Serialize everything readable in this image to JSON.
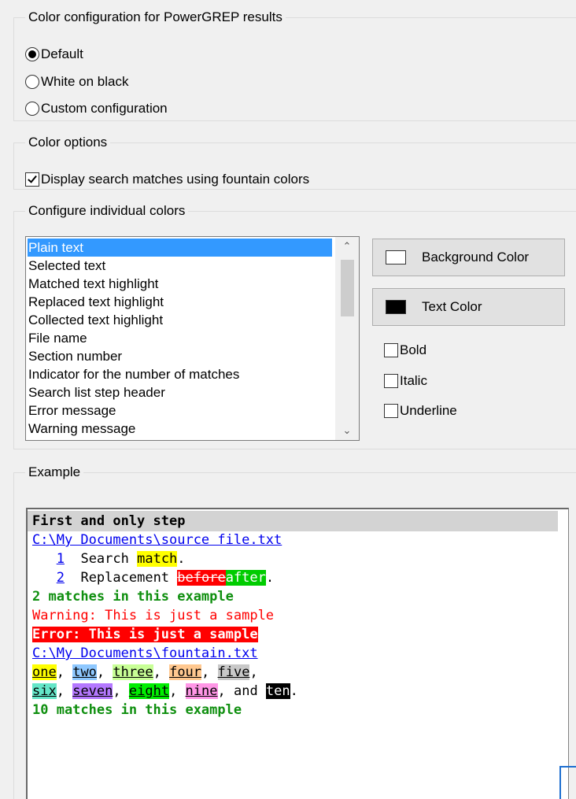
{
  "color_config": {
    "legend": "Color configuration for PowerGREP results",
    "options": [
      {
        "label": "Default",
        "selected": true
      },
      {
        "label": "White on black",
        "selected": false
      },
      {
        "label": "Custom configuration",
        "selected": false
      }
    ]
  },
  "color_options": {
    "legend": "Color options",
    "fountain_label": "Display search matches using fountain colors",
    "fountain_checked": true
  },
  "individual": {
    "legend": "Configure individual colors",
    "items": [
      "Plain text",
      "Selected text",
      "Matched text highlight",
      "Replaced text highlight",
      "Collected text highlight",
      "File name",
      "Section number",
      "Indicator for the number of matches",
      "Search list step header",
      "Error message",
      "Warning message"
    ],
    "selected_index": 0,
    "background_button": "Background Color",
    "text_button": "Text Color",
    "background_swatch": "#ffffff",
    "text_swatch": "#000000",
    "bold_label": "Bold",
    "italic_label": "Italic",
    "underline_label": "Underline"
  },
  "example": {
    "legend": "Example",
    "step_header": "First and only step",
    "file1": "C:\\My Documents\\source file.txt",
    "line1_num": "1",
    "line1_text": "Search ",
    "line1_match": "match",
    "line1_end": ".",
    "line2_num": "2",
    "line2_text": "Replacement ",
    "line2_before": "before",
    "line2_after": "after",
    "line2_end": ".",
    "count1": "2 matches in this example",
    "warning": "Warning: This is just a sample",
    "error": "Error: This is just a sample",
    "file2": "C:\\My Documents\\fountain.txt",
    "fountain_words": [
      "one",
      "two",
      "three",
      "four",
      "five",
      "six",
      "seven",
      "eight",
      "nine",
      "ten"
    ],
    "sep": ", ",
    "and_text": ", and ",
    "end_text": ".",
    "count2": "10 matches in this example"
  }
}
